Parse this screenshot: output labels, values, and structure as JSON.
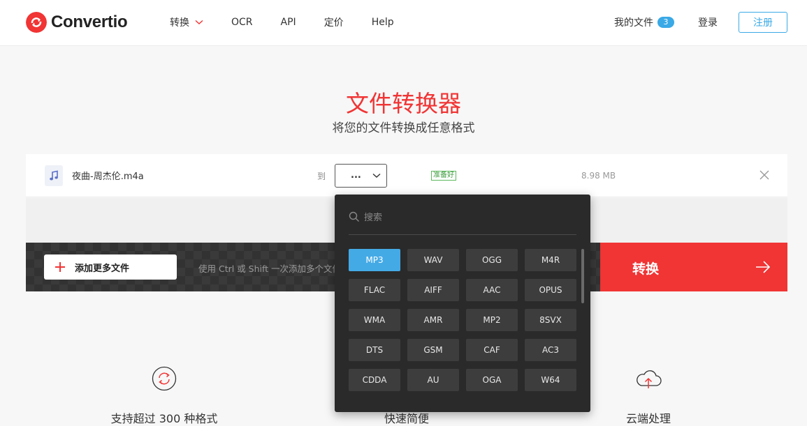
{
  "header": {
    "logo_text": "Convertio",
    "nav": [
      {
        "label": "转换",
        "has_dropdown": true
      },
      {
        "label": "OCR"
      },
      {
        "label": "API"
      },
      {
        "label": "定价"
      },
      {
        "label": "Help"
      }
    ],
    "my_files_label": "我的文件",
    "my_files_count": "3",
    "login_label": "登录",
    "signup_label": "注册"
  },
  "hero": {
    "title": "文件转换器",
    "subtitle": "将您的文件转换成任意格式"
  },
  "file": {
    "name": "夜曲-周杰伦.m4a",
    "to_label": "到",
    "selected_format": "...",
    "status": "准备好",
    "size": "8.98 MB"
  },
  "action": {
    "add_label": "添加更多文件",
    "hint": "使用 Ctrl 或 Shift 一次添加多个文件",
    "convert_label": "转换"
  },
  "features": [
    {
      "label": "支持超过 300 种格式",
      "icon": "refresh-icon"
    },
    {
      "label": "快速简便",
      "icon": "gear-icon"
    },
    {
      "label": "云端处理",
      "icon": "cloud-upload-icon"
    }
  ],
  "dropdown": {
    "search_placeholder": "搜索",
    "active_format": "MP3",
    "formats": [
      "MP3",
      "WAV",
      "OGG",
      "M4R",
      "FLAC",
      "AIFF",
      "AAC",
      "OPUS",
      "WMA",
      "AMR",
      "MP2",
      "8SVX",
      "DTS",
      "GSM",
      "CAF",
      "AC3",
      "CDDA",
      "AU",
      "OGA",
      "W64"
    ]
  },
  "colors": {
    "brand_red": "#f13434",
    "accent_blue": "#3aa9e6",
    "dropdown_bg": "#2a2a2a"
  }
}
